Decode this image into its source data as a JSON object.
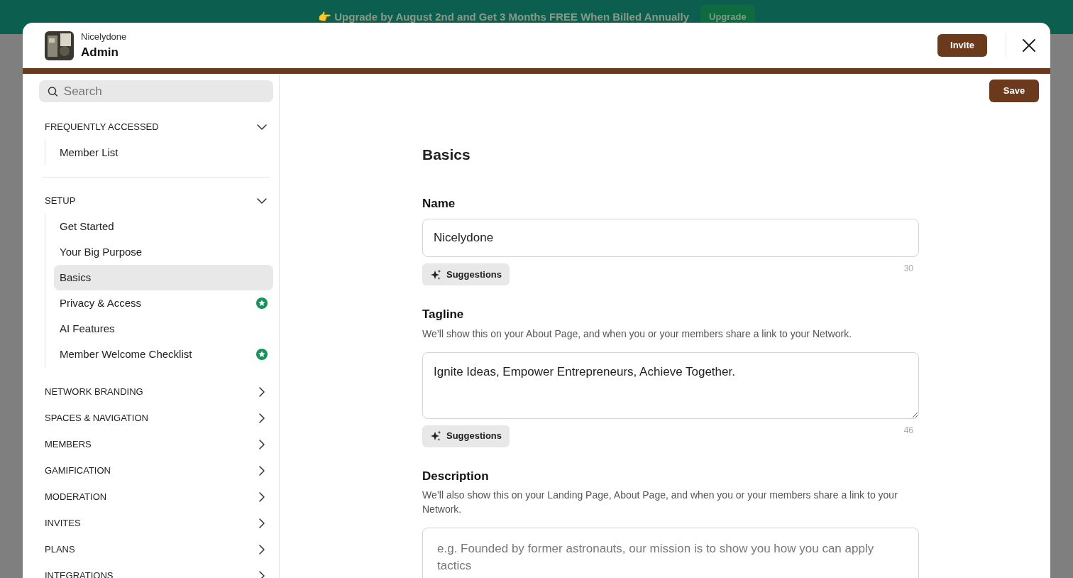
{
  "banner": {
    "icon": "👉",
    "text": "Upgrade by August 2nd and Get 3 Months FREE When Billed Annually",
    "button": "Upgrade"
  },
  "header": {
    "network": "Nicelydone",
    "title": "Admin",
    "invite": "Invite"
  },
  "sidebar": {
    "search": {
      "placeholder": "Search"
    },
    "sections": [
      {
        "label": "FREQUENTLY ACCESSED",
        "expanded": true,
        "items": [
          {
            "label": "Member List",
            "selected": false,
            "starred": false
          }
        ]
      },
      {
        "label": "SETUP",
        "expanded": true,
        "items": [
          {
            "label": "Get Started",
            "selected": false,
            "starred": false
          },
          {
            "label": "Your Big Purpose",
            "selected": false,
            "starred": false
          },
          {
            "label": "Basics",
            "selected": true,
            "starred": false
          },
          {
            "label": "Privacy & Access",
            "selected": false,
            "starred": true
          },
          {
            "label": "AI Features",
            "selected": false,
            "starred": false
          },
          {
            "label": "Member Welcome Checklist",
            "selected": false,
            "starred": true
          }
        ]
      },
      {
        "label": "NETWORK BRANDING",
        "expanded": false
      },
      {
        "label": "SPACES & NAVIGATION",
        "expanded": false
      },
      {
        "label": "MEMBERS",
        "expanded": false
      },
      {
        "label": "GAMIFICATION",
        "expanded": false
      },
      {
        "label": "MODERATION",
        "expanded": false
      },
      {
        "label": "INVITES",
        "expanded": false
      },
      {
        "label": "PLANS",
        "expanded": false
      },
      {
        "label": "INTEGRATIONS",
        "expanded": false
      }
    ]
  },
  "content": {
    "save": "Save",
    "heading": "Basics",
    "fields": [
      {
        "kind": "input",
        "label": "Name",
        "value": "Nicelydone",
        "suggestions": "Suggestions",
        "count": "30"
      },
      {
        "kind": "textarea",
        "label": "Tagline",
        "help": "We’ll show this on your About Page, and when you or your members share a link to your Network.",
        "value": "Ignite Ideas, Empower Entrepreneurs, Achieve Together.",
        "suggestions": "Suggestions",
        "count": "46"
      },
      {
        "kind": "textarea",
        "label": "Description",
        "help": "We’ll also show this on your Landing Page, About Page, and when you or your members share a link to your Network.",
        "placeholder": "e.g. Founded by former astronauts, our mission is to show you how you can apply tactics"
      }
    ]
  }
}
